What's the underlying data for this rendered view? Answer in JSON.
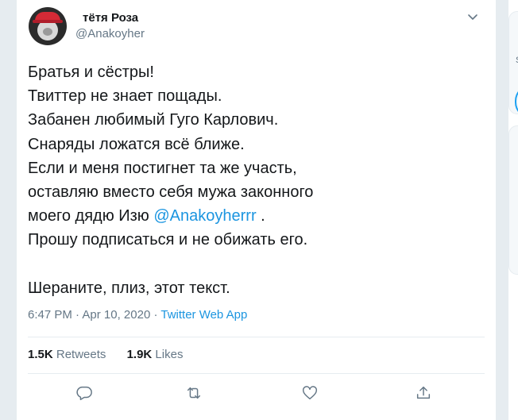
{
  "tweet": {
    "display_name": "тётя Роза",
    "handle": "@Anakoyher",
    "lines": [
      "Братья и сёстры!",
      "Твиттер не знает пощады.",
      "Забанен любимый Гуго Карлович.",
      "Снаряды ложатся всё ближе.",
      "Если и меня постигнет та же участь,",
      "оставляю вместо себя мужа законного"
    ],
    "line7_before": "моего дядю Изю ",
    "mention": "@Anakoyherrr",
    "line7_after": " .",
    "line8": "Прошу подписаться и не обижать его.",
    "line10": "Шераните, плиз, этот текст.",
    "time": "6:47 PM",
    "sep1": " · ",
    "date": "Apr 10, 2020",
    "sep2": " · ",
    "source": "Twitter Web App",
    "retweets_count": "1.5K",
    "retweets_label": "Retweets",
    "likes_count": "1.9K",
    "likes_label": "Likes"
  },
  "sidebar": {
    "letter": "S"
  },
  "colors": {
    "accent": "#1da1f2",
    "link": "#1b95e0",
    "text": "#14171a",
    "secondary": "#657786"
  },
  "icons": [
    "chevron-down-icon",
    "reply-icon",
    "retweet-icon",
    "like-icon",
    "share-icon"
  ]
}
